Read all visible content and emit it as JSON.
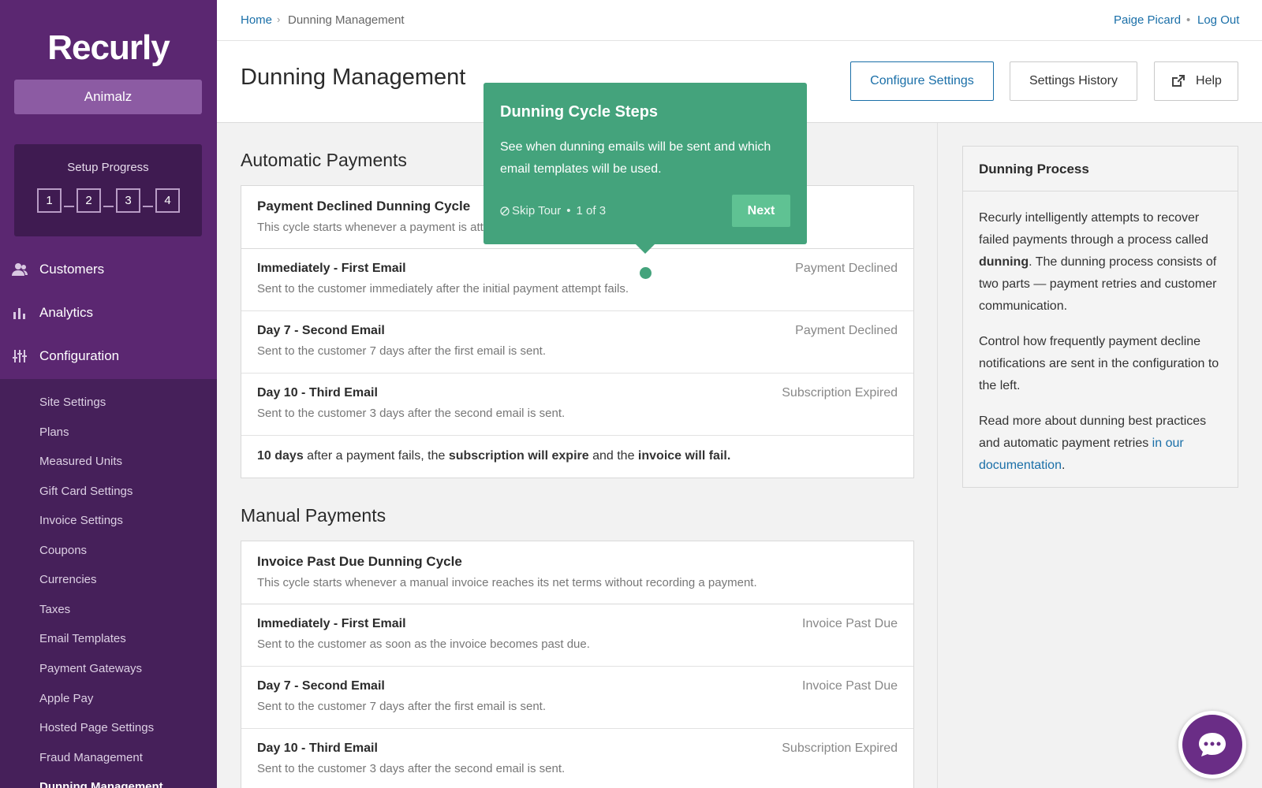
{
  "brand": {
    "logo": "Recurly",
    "account": "Animalz"
  },
  "setup": {
    "title": "Setup Progress",
    "steps": [
      "1",
      "2",
      "3",
      "4"
    ]
  },
  "nav": {
    "customers": "Customers",
    "analytics": "Analytics",
    "configuration": "Configuration",
    "sub": [
      "Site Settings",
      "Plans",
      "Measured Units",
      "Gift Card Settings",
      "Invoice Settings",
      "Coupons",
      "Currencies",
      "Taxes",
      "Email Templates",
      "Payment Gateways",
      "Apple Pay",
      "Hosted Page Settings",
      "Fraud Management",
      "Dunning Management"
    ]
  },
  "breadcrumb": {
    "home": "Home",
    "sep": "›",
    "current": "Dunning Management"
  },
  "user": {
    "name": "Paige Picard",
    "sep": "•",
    "logout": "Log Out"
  },
  "page": {
    "title": "Dunning Management"
  },
  "buttons": {
    "configure": "Configure Settings",
    "history": "Settings History",
    "help": "Help"
  },
  "automatic": {
    "title": "Automatic Payments",
    "card_title": "Payment Declined Dunning Cycle",
    "card_desc": "This cycle starts whenever a payment is att",
    "rows": [
      {
        "title": "Immediately - First Email",
        "desc": "Sent to the customer immediately after the initial payment attempt fails.",
        "status": "Payment Declined"
      },
      {
        "title": "Day 7 - Second Email",
        "desc": "Sent to the customer 7 days after the first email is sent.",
        "status": "Payment Declined"
      },
      {
        "title": "Day 10 - Third Email",
        "desc": "Sent to the customer 3 days after the second email is sent.",
        "status": "Subscription Expired"
      }
    ],
    "footer": {
      "p1": "10 days",
      "t1": " after a payment fails, the ",
      "p2": "subscription will expire",
      "t2": " and the ",
      "p3": "invoice will fail."
    }
  },
  "manual": {
    "title": "Manual Payments",
    "card_title": "Invoice Past Due Dunning Cycle",
    "card_desc": "This cycle starts whenever a manual invoice reaches its net terms without recording a payment.",
    "rows": [
      {
        "title": "Immediately - First Email",
        "desc": "Sent to the customer as soon as the invoice becomes past due.",
        "status": "Invoice Past Due"
      },
      {
        "title": "Day 7 - Second Email",
        "desc": "Sent to the customer 7 days after the first email is sent.",
        "status": "Invoice Past Due"
      },
      {
        "title": "Day 10 - Third Email",
        "desc": "Sent to the customer 3 days after the second email is sent.",
        "status": "Subscription Expired"
      }
    ]
  },
  "panel": {
    "title": "Dunning Process",
    "p1a": "Recurly intelligently attempts to recover failed payments through a process called ",
    "p1b": "dunning",
    "p1c": ". The dunning process consists of two parts — payment retries and customer communication.",
    "p2": "Control how frequently payment decline notifications are sent in the configuration to the left.",
    "p3a": "Read more about dunning best practices and automatic payment retries ",
    "p3link": "in our documentation",
    "p3b": "."
  },
  "tour": {
    "title": "Dunning Cycle Steps",
    "text": "See when dunning emails will be sent and which email templates will be used.",
    "skip": "Skip Tour",
    "sep": "•",
    "progress": "1 of 3",
    "next": "Next"
  },
  "colors": {
    "sidebar": "#5b2771",
    "accent": "#1a6fa8",
    "tour": "#44a37c"
  }
}
